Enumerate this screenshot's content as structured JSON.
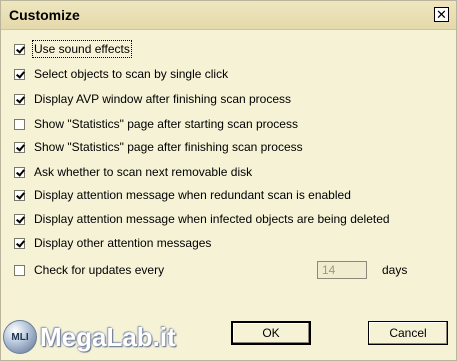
{
  "window": {
    "title": "Customize",
    "close_glyph": "✕"
  },
  "options": [
    {
      "label": "Use sound effects",
      "checked": true
    },
    {
      "label": "Select objects to scan by single click",
      "checked": true
    },
    {
      "label": "Display AVP window after finishing scan process",
      "checked": true
    },
    {
      "label": "Show \"Statistics\" page after starting scan process",
      "checked": false
    },
    {
      "label": "Show \"Statistics\" page after finishing scan process",
      "checked": true
    },
    {
      "label": "Ask whether to scan next removable disk",
      "checked": true
    },
    {
      "label": "Display attention message when redundant scan is enabled",
      "checked": true
    },
    {
      "label": "Display attention message when infected objects are being deleted",
      "checked": true
    },
    {
      "label": "Display other attention messages",
      "checked": true
    },
    {
      "label": "Check for updates every",
      "checked": false
    }
  ],
  "update_days": {
    "value": "14",
    "unit": "days"
  },
  "buttons": {
    "ok": "OK",
    "cancel": "Cancel"
  },
  "watermark": {
    "badge": "MLI",
    "text": "MegaLab.it"
  }
}
